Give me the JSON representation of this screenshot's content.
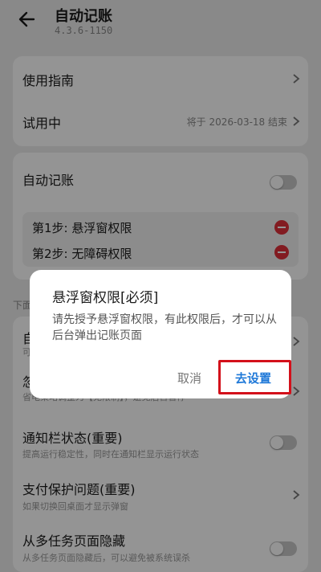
{
  "header": {
    "title": "自动记账",
    "version": "4.3.6-1150"
  },
  "card1": {
    "guide_label": "使用指南",
    "trial_label": "试用中",
    "trial_value": "将于 2026-03-18 结束"
  },
  "card2": {
    "auto_label": "自动记账",
    "steps": [
      {
        "label": "第1步: 悬浮窗权限"
      },
      {
        "label": "第2步: 无障碍权限"
      }
    ]
  },
  "section": {
    "partial_label": "下面"
  },
  "card3": {
    "row1_partial": "自",
    "row1_sub_partial": "可",
    "row2_partial": "忽",
    "row2_sub_partial": "省电策略调整为【无限制】，避免后台冒停",
    "notify_label": "通知栏状态(重要)",
    "notify_sub": "提高运行稳定性，同时在通知栏显示运行状态",
    "pay_label": "支付保护问题(重要)",
    "pay_sub": "如果切换回桌面才显示弹窗",
    "hide_label": "从多任务页面隐藏",
    "hide_sub": "从多任务页面隐藏后，可以避免被系统误杀"
  },
  "dialog": {
    "title": "悬浮窗权限[必须]",
    "message": "请先授予悬浮窗权限，有此权限后，才可以从后台弹出记账页面",
    "cancel": "取消",
    "confirm": "去设置"
  },
  "colors": {
    "accent": "#1e78d8",
    "danger": "#e0303a",
    "highlight": "#d3101a"
  },
  "icons": [
    "back-arrow-icon",
    "chevron-right-icon",
    "minus-circle-icon",
    "toggle-switch"
  ]
}
